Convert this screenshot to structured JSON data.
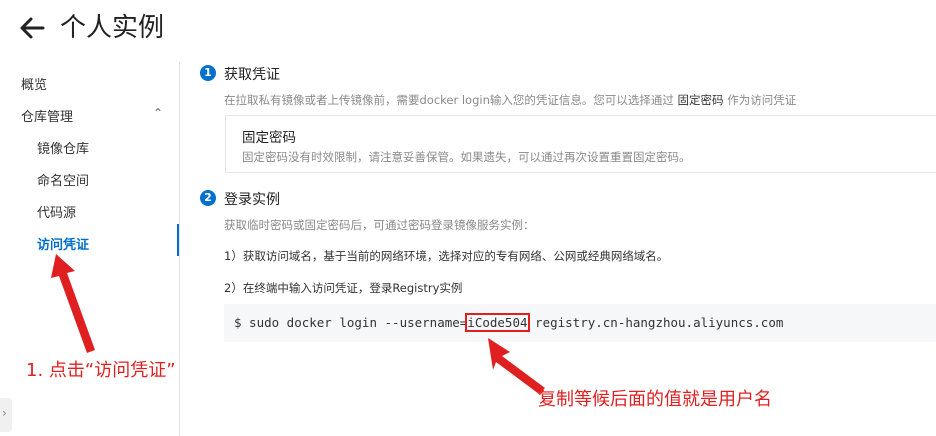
{
  "header": {
    "title": "个人实例"
  },
  "sidebar": {
    "overview": "概览",
    "repo_management": "仓库管理",
    "repo_items": [
      "镜像仓库",
      "命名空间",
      "代码源",
      "访问凭证"
    ]
  },
  "step1": {
    "num": "1",
    "title": "获取凭证",
    "desc_prefix": "在拉取私有镜像或者上传镜像前，需要docker login输入您的凭证信息。您可以选择通过",
    "desc_bold": "固定密码",
    "desc_suffix": "作为访问凭证",
    "card": {
      "title": "固定密码",
      "desc": "固定密码没有时效限制，请注意妥善保管。如果遗失，可以通过再次设置重置固定密码。"
    }
  },
  "step2": {
    "num": "2",
    "title": "登录实例",
    "desc": "获取临时密码或固定密码后，可通过密码登录镜像服务实例：",
    "line1": "1）获取访问域名，基于当前的网络环境，选择对应的专有网络、公网或经典网络域名。",
    "line2": "2）在终端中输入访问凭证，登录Registry实例",
    "code_prefix": "$ sudo docker login --username=",
    "code_username": "iCode504",
    "code_suffix": " registry.cn-hangzhou.aliyuncs.com"
  },
  "annotations": {
    "click_hint": "1. 点击“访问凭证”",
    "copy_hint": "复制等候后面的值就是用户名"
  },
  "colors": {
    "accent": "#0070cc",
    "annotation": "#e02020"
  }
}
